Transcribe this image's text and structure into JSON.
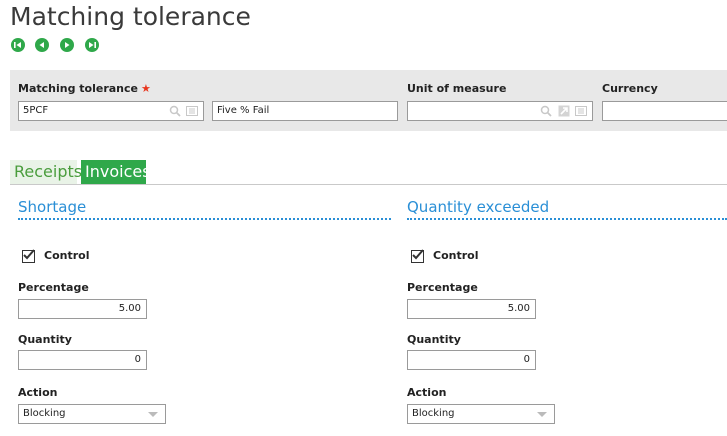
{
  "page": {
    "title": "Matching tolerance"
  },
  "nav": {
    "icons": [
      "first-record-icon",
      "previous-record-icon",
      "next-record-icon",
      "last-record-icon"
    ]
  },
  "header": {
    "matching_tolerance_label": "Matching tolerance",
    "required_mark": "★",
    "code_value": "5PCF",
    "description_value": "Five % Fail",
    "unit_of_measure_label": "Unit of measure",
    "unit_of_measure_value": "",
    "currency_label": "Currency",
    "currency_value": ""
  },
  "tabs": [
    {
      "label": "Receipts",
      "active": false
    },
    {
      "label": "Invoices",
      "active": true
    }
  ],
  "shortage": {
    "title": "Shortage",
    "control_label": "Control",
    "control_checked": true,
    "percentage_label": "Percentage",
    "percentage_value": "5.00",
    "quantity_label": "Quantity",
    "quantity_value": "0",
    "action_label": "Action",
    "action_value": "Blocking"
  },
  "exceeded": {
    "title": "Quantity exceeded",
    "control_label": "Control",
    "control_checked": true,
    "percentage_label": "Percentage",
    "percentage_value": "5.00",
    "quantity_label": "Quantity",
    "quantity_value": "0",
    "action_label": "Action",
    "action_value": "Blocking"
  },
  "colors": {
    "accent_green": "#2fa84a",
    "section_blue": "#2a8fd6",
    "required_red": "#e8371f"
  }
}
